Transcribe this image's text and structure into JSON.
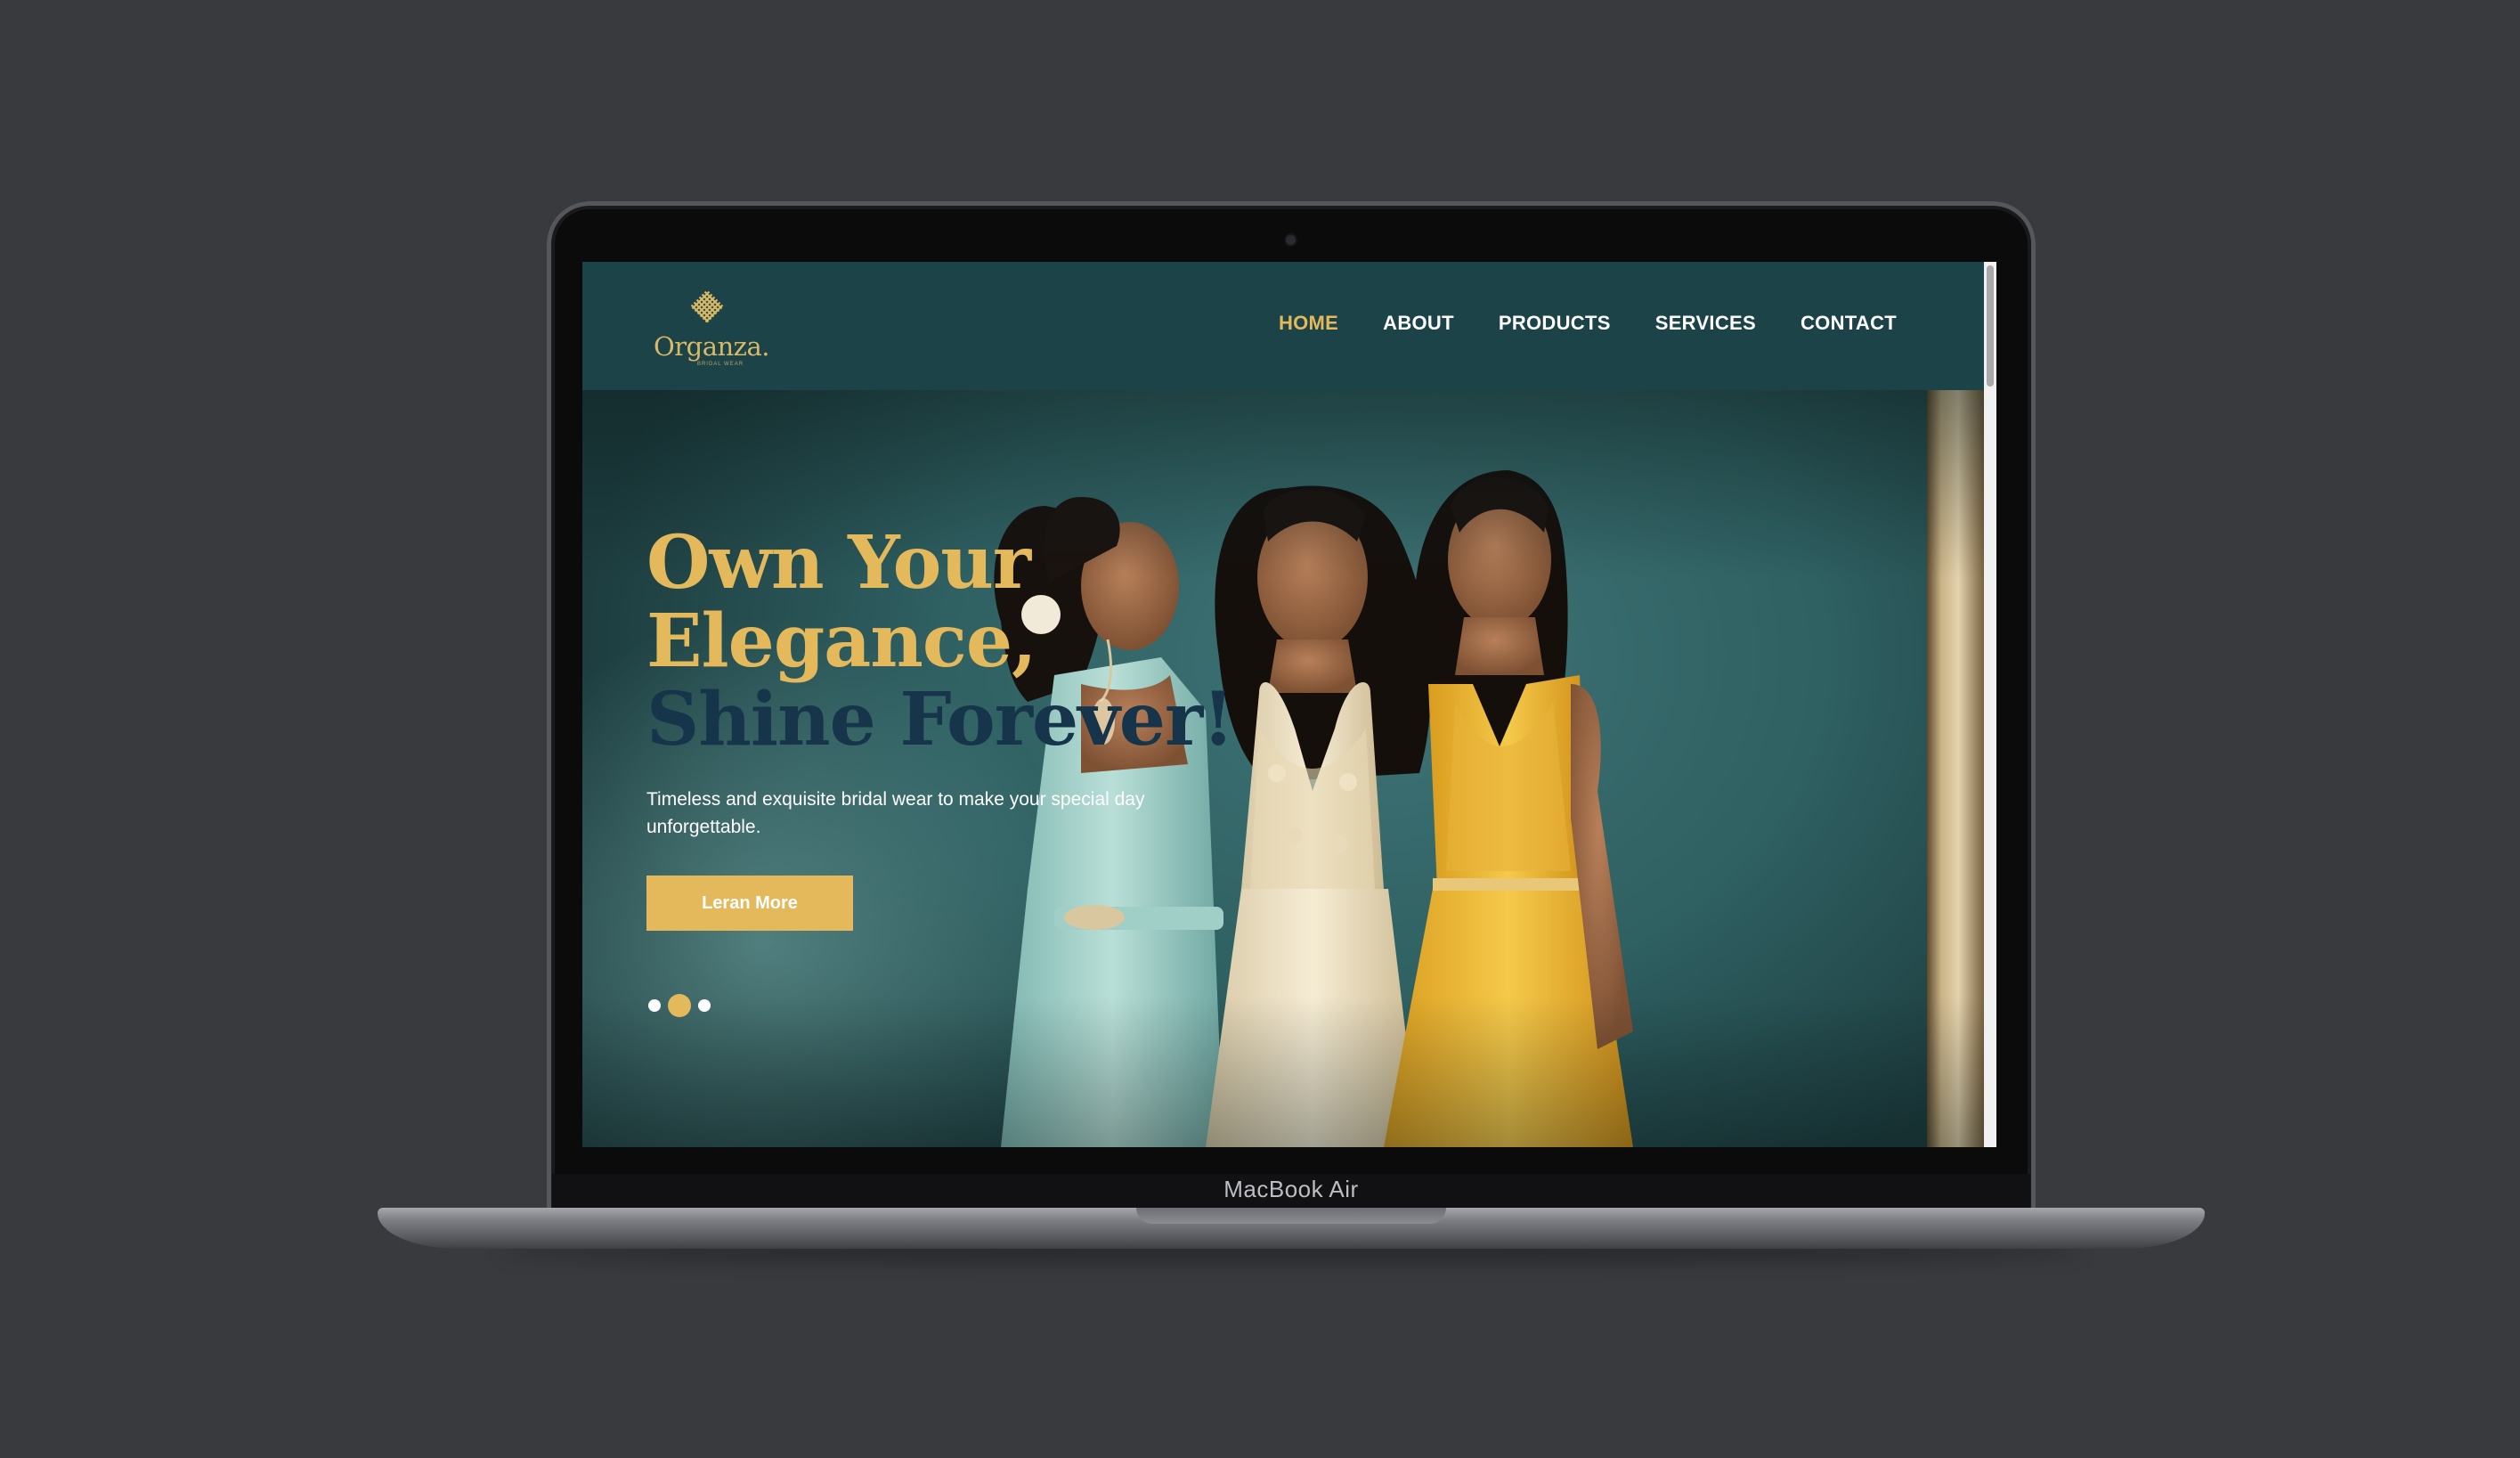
{
  "device": {
    "model_label": "MacBook Air"
  },
  "brand": {
    "name": "Organza.",
    "tagline": "BRIDAL WEAR"
  },
  "nav": {
    "items": [
      {
        "label": "HOME",
        "active": true
      },
      {
        "label": "ABOUT",
        "active": false
      },
      {
        "label": "PRODUCTS",
        "active": false
      },
      {
        "label": "SERVICES",
        "active": false
      },
      {
        "label": "CONTACT",
        "active": false
      }
    ]
  },
  "hero": {
    "headline_line1": "Own Your",
    "headline_line2": "Elegance,",
    "headline_line3": "Shine Forever!",
    "subtext": "Timeless and exquisite bridal wear to make your special day unforgettable.",
    "cta_label": "Leran More",
    "carousel": {
      "slides": 3,
      "active_index": 1
    }
  },
  "colors": {
    "page_background": "#393a3e",
    "header_teal": "#1b4348",
    "accent_gold": "#e4b95c",
    "headline_navy": "#16354a",
    "text_white": "#ffffff"
  }
}
